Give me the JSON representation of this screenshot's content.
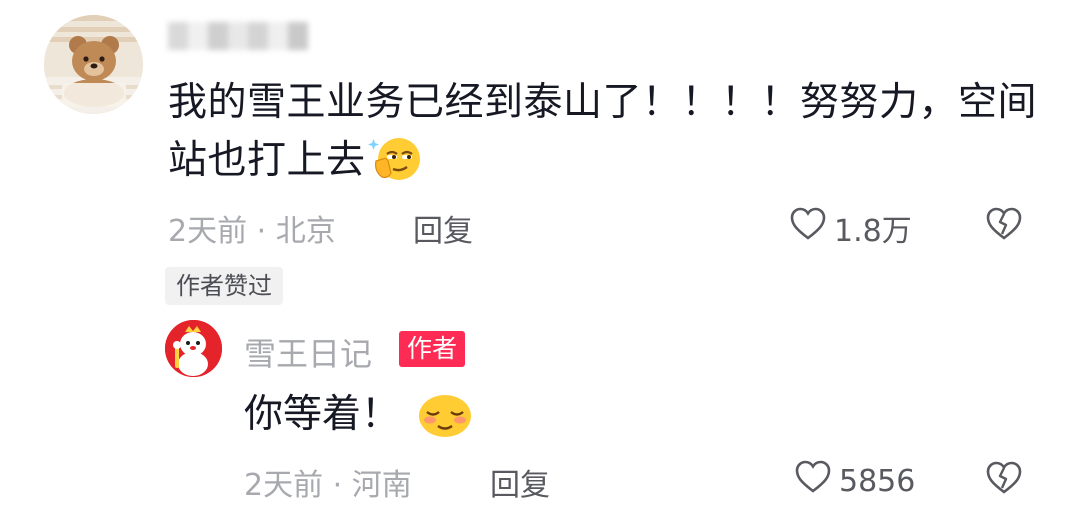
{
  "comment": {
    "text": "我的雪王业务已经到泰山了！！！！努努力，空间站也打上去",
    "emoji_icon": "smirk-hand-emoji-icon",
    "time_location": "2天前 · 北京",
    "reply_label": "回复",
    "like_count": "1.8万",
    "liked_by_author_badge": "作者赞过"
  },
  "reply": {
    "username": "雪王日记",
    "author_badge": "作者",
    "text": "你等着！",
    "emoji_icon": "blushing-smile-emoji-icon",
    "time_location": "2天前 · 河南",
    "reply_label": "回复",
    "like_count": "5856"
  },
  "colors": {
    "primary_text": "#161823",
    "secondary_text": "#a7a9ae",
    "author_badge_bg": "#fe2c55",
    "reply_avatar_bg": "#e4232a"
  }
}
